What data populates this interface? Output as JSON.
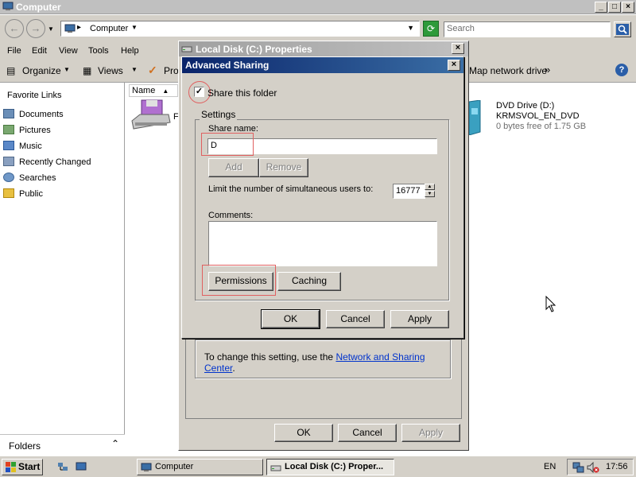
{
  "explorer": {
    "title": "Computer",
    "address": "Computer",
    "search_placeholder": "Search",
    "menu": [
      "File",
      "Edit",
      "View",
      "Tools",
      "Help"
    ],
    "toolbar": {
      "organize": "Organize",
      "views": "Views",
      "properties_partial": "Pro",
      "map_drive": "Map network drive",
      "more": "»"
    },
    "left_pane": {
      "heading": "Favorite Links",
      "items": [
        "Documents",
        "Pictures",
        "Music",
        "Recently Changed",
        "Searches",
        "Public"
      ],
      "folders_label": "Folders"
    },
    "column_name": "Name",
    "partial_item_label": "F",
    "dvd": {
      "name": "DVD Drive (D:)",
      "label": "KRMSVOL_EN_DVD",
      "space": "0 bytes free of 1.75 GB"
    }
  },
  "properties_dialog": {
    "title": "Local Disk (C:) Properties",
    "change_setting_text": "To change this setting, use the ",
    "link_text": "Network and Sharing Center",
    "link_suffix": ".",
    "ok": "OK",
    "cancel": "Cancel",
    "apply": "Apply"
  },
  "advanced_sharing": {
    "title": "Advanced Sharing",
    "share_checkbox_label": "Share this folder",
    "share_checked": true,
    "settings_label": "Settings",
    "share_name_label": "Share name:",
    "share_name_value": "D",
    "add": "Add",
    "remove": "Remove",
    "limit_label": "Limit the number of simultaneous users to:",
    "limit_value": "16777",
    "comments_label": "Comments:",
    "comments_value": "",
    "permissions": "Permissions",
    "caching": "Caching",
    "ok": "OK",
    "cancel": "Cancel",
    "apply": "Apply"
  },
  "taskbar": {
    "start": "Start",
    "tasks": [
      "Computer",
      "Local Disk (C:) Proper..."
    ],
    "language": "EN",
    "clock": "17:56"
  }
}
